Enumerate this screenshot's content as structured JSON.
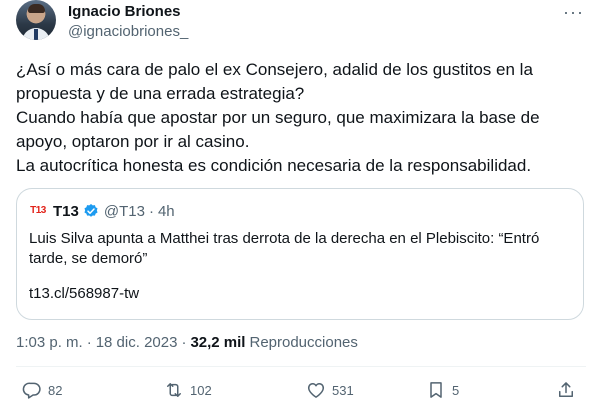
{
  "tweet": {
    "author_name": "Ignacio Briones",
    "author_handle": "@ignaciobriones_",
    "text_lines": [
      "¿Así o más cara de palo el ex Consejero, adalid de los gustitos en la",
      "propuesta y de una errada estrategia?",
      "Cuando había que apostar por un seguro, que maximizara la base de",
      "apoyo, optaron por ir al casino.",
      "La autocrítica honesta es condición necesaria de la responsabilidad."
    ],
    "time": "1:03 p. m.",
    "date": "18 dic. 2023",
    "separator": "·",
    "views_count": "32,2 mil",
    "views_label": "Reproducciones"
  },
  "quoted": {
    "logo_text": "T13",
    "name": "T13",
    "handle": "@T13",
    "time": "4h",
    "separator": "·",
    "text": "Luis Silva apunta a Matthei tras derrota de la derecha en el Plebiscito: “Entró tarde, se demoró”",
    "link": "t13.cl/568987-tw"
  },
  "actions": {
    "replies": "82",
    "retweets": "102",
    "likes": "531",
    "bookmarks": "5"
  },
  "colors": {
    "text": "#0f1419",
    "secondary": "#536471",
    "border": "#cfd9de",
    "verified": "#1d9bf0",
    "t13_red": "#e2231a"
  }
}
